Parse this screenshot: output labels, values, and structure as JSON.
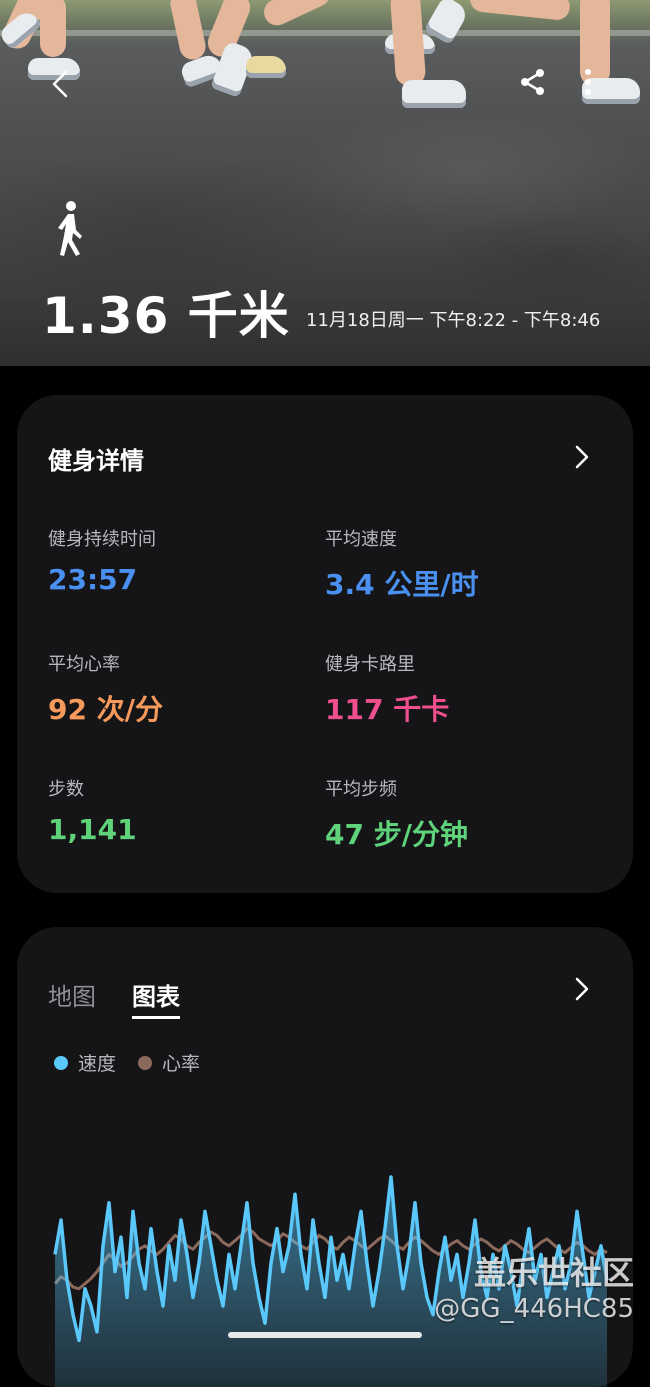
{
  "hero": {
    "distance": "1.36 千米",
    "session_time": "11月18日周一 下午8:22 - 下午8:46",
    "activity_icon": "walking-person-icon",
    "back_icon": "back-arrow-icon",
    "share_icon": "share-icon",
    "more_icon": "more-vertical-icon"
  },
  "details": {
    "title": "健身详情",
    "stats": [
      {
        "label": "健身持续时间",
        "value": "23:57",
        "color": "#4a90f0"
      },
      {
        "label": "平均速度",
        "value": "3.4 公里/时",
        "color": "#4a90f0"
      },
      {
        "label": "平均心率",
        "value": "92 次/分",
        "color": "#f59a5b"
      },
      {
        "label": "健身卡路里",
        "value": "117 千卡",
        "color": "#ef4f8e"
      },
      {
        "label": "步数",
        "value": "1,141",
        "color": "#5fd37a"
      },
      {
        "label": "平均步频",
        "value": "47 步/分钟",
        "color": "#5fd37a"
      }
    ]
  },
  "chart_section": {
    "tabs": [
      {
        "label": "地图",
        "active": false
      },
      {
        "label": "图表",
        "active": true
      }
    ]
  },
  "chart_data": {
    "type": "line",
    "title": "",
    "xlabel": "",
    "ylabel": "",
    "legend_placement": "top-left",
    "grid": false,
    "series": [
      {
        "name": "速度",
        "color": "#5ac8fa",
        "values": [
          0.55,
          0.75,
          0.4,
          0.2,
          0.05,
          0.35,
          0.25,
          0.1,
          0.6,
          0.85,
          0.45,
          0.65,
          0.3,
          0.8,
          0.5,
          0.35,
          0.7,
          0.45,
          0.25,
          0.6,
          0.4,
          0.75,
          0.55,
          0.3,
          0.5,
          0.8,
          0.6,
          0.4,
          0.25,
          0.55,
          0.35,
          0.6,
          0.85,
          0.5,
          0.3,
          0.15,
          0.5,
          0.7,
          0.45,
          0.6,
          0.9,
          0.55,
          0.35,
          0.75,
          0.5,
          0.3,
          0.65,
          0.4,
          0.55,
          0.35,
          0.6,
          0.8,
          0.5,
          0.25,
          0.45,
          0.7,
          1.0,
          0.6,
          0.35,
          0.55,
          0.85,
          0.5,
          0.3,
          0.2,
          0.45,
          0.65,
          0.4,
          0.55,
          0.3,
          0.5,
          0.75,
          0.45,
          0.3,
          0.55,
          0.35,
          0.6,
          0.45,
          0.25,
          0.5,
          0.7,
          0.4,
          0.55,
          0.3,
          0.45,
          0.6,
          0.35,
          0.5,
          0.8,
          0.55,
          0.3,
          0.45,
          0.6,
          0.4
        ]
      },
      {
        "name": "心率",
        "color": "#8b6a5c",
        "values": [
          0.38,
          0.42,
          0.4,
          0.36,
          0.35,
          0.38,
          0.41,
          0.45,
          0.5,
          0.55,
          0.52,
          0.48,
          0.5,
          0.54,
          0.58,
          0.6,
          0.57,
          0.55,
          0.58,
          0.62,
          0.66,
          0.64,
          0.6,
          0.58,
          0.62,
          0.65,
          0.68,
          0.66,
          0.62,
          0.6,
          0.63,
          0.66,
          0.7,
          0.68,
          0.64,
          0.62,
          0.6,
          0.63,
          0.67,
          0.65,
          0.62,
          0.6,
          0.58,
          0.62,
          0.66,
          0.64,
          0.6,
          0.58,
          0.62,
          0.65,
          0.63,
          0.6,
          0.58,
          0.61,
          0.64,
          0.66,
          0.63,
          0.6,
          0.58,
          0.62,
          0.65,
          0.63,
          0.6,
          0.57,
          0.55,
          0.58,
          0.61,
          0.63,
          0.6,
          0.58,
          0.61,
          0.64,
          0.62,
          0.59,
          0.57,
          0.6,
          0.63,
          0.61,
          0.58,
          0.56,
          0.59,
          0.62,
          0.64,
          0.61,
          0.58,
          0.56,
          0.59,
          0.62,
          0.6,
          0.57,
          0.55,
          0.58,
          0.56
        ]
      }
    ]
  },
  "watermark": {
    "line1": "盖乐世社区",
    "line2": "@GG_446HC85"
  }
}
